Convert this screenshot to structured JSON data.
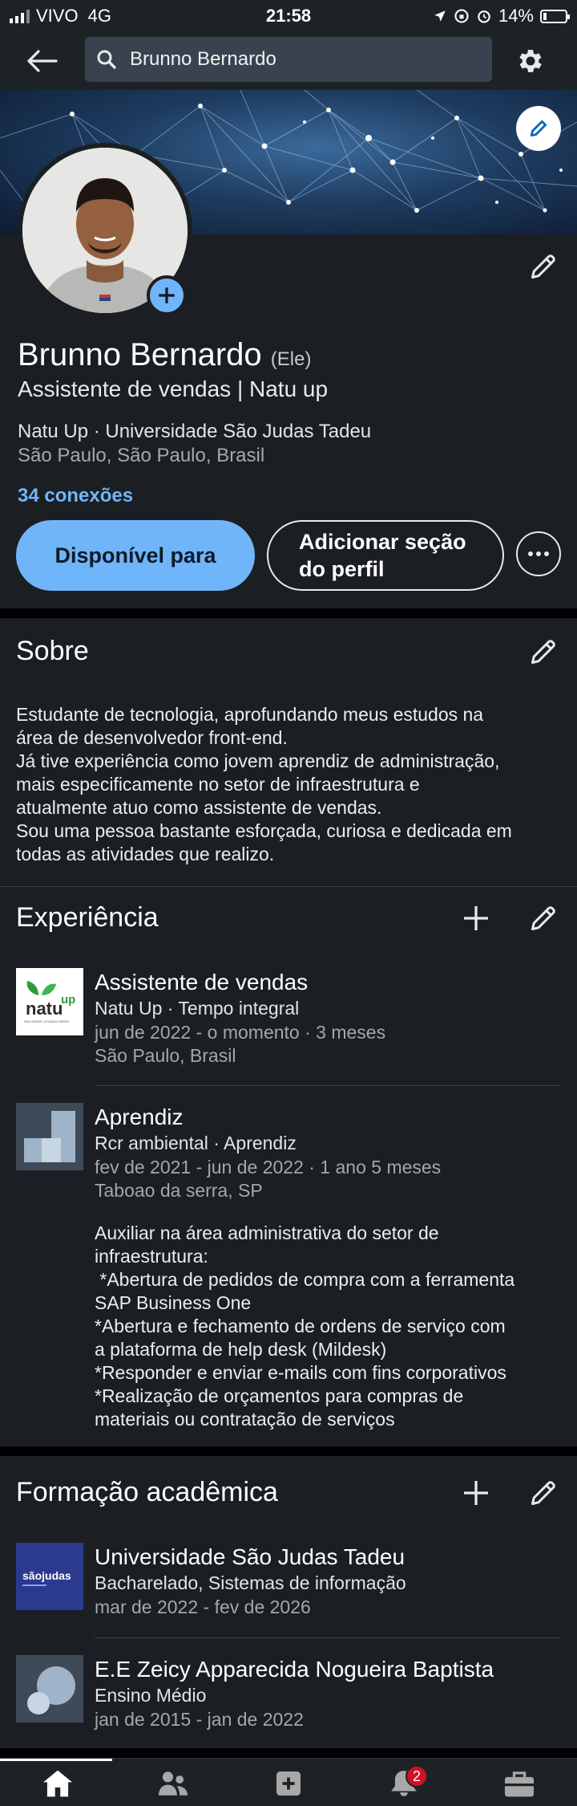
{
  "status_bar": {
    "carrier": "VIVO",
    "network": "4G",
    "time": "21:58",
    "battery": "14%"
  },
  "search": {
    "value": "Brunno Bernardo"
  },
  "profile": {
    "name": "Brunno Bernardo",
    "pronouns": "(Ele)",
    "headline": "Assistente de vendas | Natu up",
    "org_line": "Natu Up · Universidade São Judas Tadeu",
    "location": "São Paulo, São Paulo, Brasil",
    "connections": "34 conexões"
  },
  "actions": {
    "open_to": "Disponível para",
    "add_section_line1": "Adicionar seção",
    "add_section_line2": "do perfil"
  },
  "about": {
    "title": "Sobre",
    "lines": [
      "Estudante de tecnologia, aprofundando meus estudos na",
      "área de desenvolvedor front-end.",
      "Já tive experiência como jovem aprendiz de administração,",
      "mais especificamente no setor de infraestrutura e",
      "atualmente atuo como assistente de vendas.",
      "Sou uma pessoa bastante esforçada, curiosa e dedicada em",
      "todas as atividades que realizo."
    ]
  },
  "experience": {
    "title": "Experiência",
    "items": [
      {
        "title": "Assistente de vendas",
        "company": "Natu Up · Tempo integral",
        "dates": "jun de 2022 - o momento · 3 meses",
        "location": "São Paulo, Brasil",
        "logo_text": "natu",
        "logo_text2": "up",
        "logo_tagline": "SUA SAÚDE LEVADA A SÉRIO"
      },
      {
        "title": "Aprendiz",
        "company": "Rcr ambiental · Aprendiz",
        "dates": "fev de 2021 - jun de 2022 · 1 ano 5 meses",
        "location": "Taboao da serra, SP",
        "description_lines": [
          "Auxiliar na área administrativa do setor de",
          "infraestrutura:",
          " *Abertura de pedidos de compra com a ferramenta",
          "SAP Business One",
          "*Abertura e fechamento de ordens de serviço com",
          "a plataforma de help desk (Mildesk)",
          "*Responder e enviar e-mails com fins corporativos",
          "*Realização de orçamentos para compras de",
          "materiais ou contratação de serviços"
        ]
      }
    ]
  },
  "education": {
    "title": "Formação acadêmica",
    "items": [
      {
        "school": "Universidade São Judas Tadeu",
        "degree": "Bacharelado, Sistemas de informação",
        "dates": "mar de 2022 - fev de 2026",
        "logo_text": "sãojudas"
      },
      {
        "school": "E.E Zeicy Apparecida Nogueira Baptista",
        "degree": "Ensino Médio",
        "dates": "jan de 2015 - jan de 2022"
      }
    ]
  },
  "bottom_nav": {
    "notification_count": "2"
  },
  "colors": {
    "accent": "#70b5f9",
    "background": "#1b1f23",
    "badge": "#d11124"
  }
}
